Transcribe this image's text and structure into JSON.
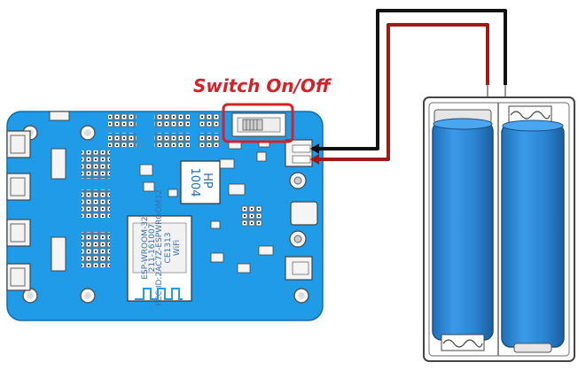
{
  "labels": {
    "switch_label": "Switch On/Off"
  },
  "board_markings": {
    "driver_chip": [
      "HP",
      "1004"
    ],
    "module_line1": "ESP-WROOM-32",
    "module_line2": "211-161007",
    "module_line3": "FCC ID:2AC7Z-ESPWROOM32",
    "module_ce": "CE1313",
    "module_brand": "WiFi"
  },
  "colors": {
    "board_blue": "#1f9be8",
    "wire_black": "#111111",
    "wire_red": "#a01818",
    "highlight_red": "#d4222a",
    "cell_blue": "#2f86d6"
  },
  "icons": {
    "wire_arrow": "arrow-left-icon"
  }
}
